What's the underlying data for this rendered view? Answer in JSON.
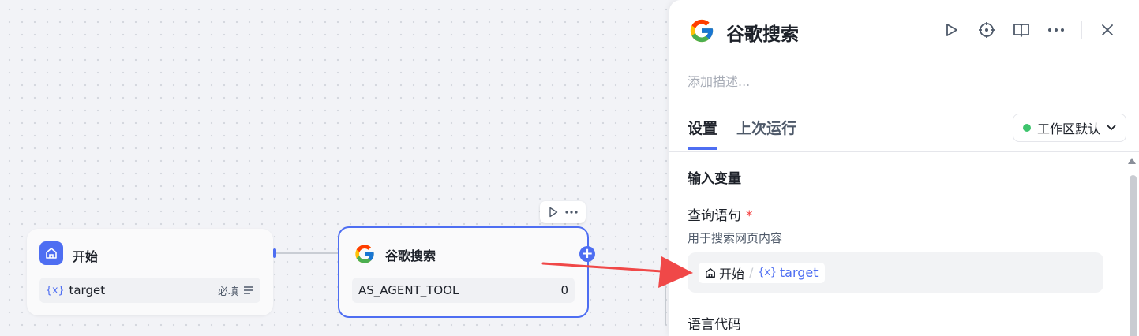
{
  "canvas": {
    "start_node": {
      "title": "开始",
      "var_tag": "{x}",
      "var_name": "target",
      "required_label": "必填"
    },
    "google_node": {
      "title": "谷歌搜索",
      "row_label": "AS_AGENT_TOOL",
      "row_value": "0",
      "add_symbol": "+"
    }
  },
  "panel": {
    "title": "谷歌搜索",
    "description_placeholder": "添加描述...",
    "tabs": [
      "设置",
      "上次运行"
    ],
    "workspace_select": "工作区默认",
    "section_title": "输入变量",
    "fields": {
      "query_label": "查询语句",
      "query_required": "*",
      "query_hint": "用于搜索网页内容",
      "query_ref_node": "开始",
      "query_ref_sep": "/",
      "query_ref_var_tag": "{x}",
      "query_ref_var": "target",
      "lang_label": "语言代码"
    }
  },
  "colors": {
    "accent": "#4e6ef2",
    "arrow": "#f04848",
    "status_green": "#3ec46d"
  }
}
